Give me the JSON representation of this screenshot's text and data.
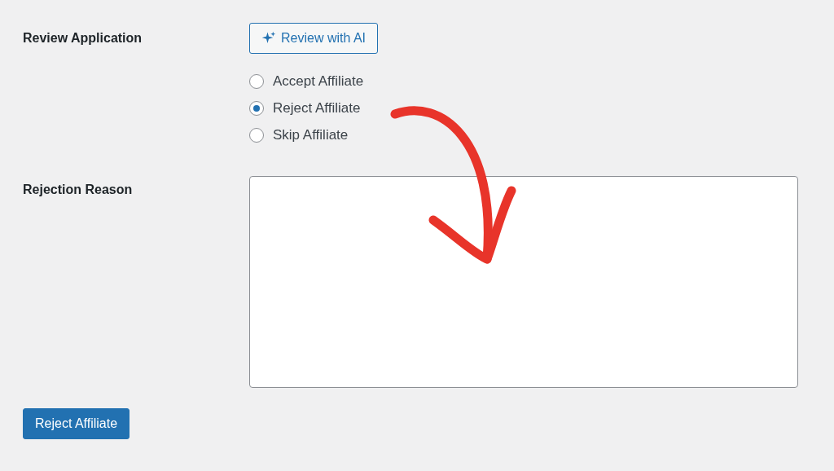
{
  "review": {
    "label": "Review Application",
    "ai_button": "Review with AI",
    "options": [
      {
        "label": "Accept Affiliate",
        "selected": false
      },
      {
        "label": "Reject Affiliate",
        "selected": true
      },
      {
        "label": "Skip Affiliate",
        "selected": false
      }
    ]
  },
  "reason": {
    "label": "Rejection Reason"
  },
  "submit": "Reject Affiliate"
}
